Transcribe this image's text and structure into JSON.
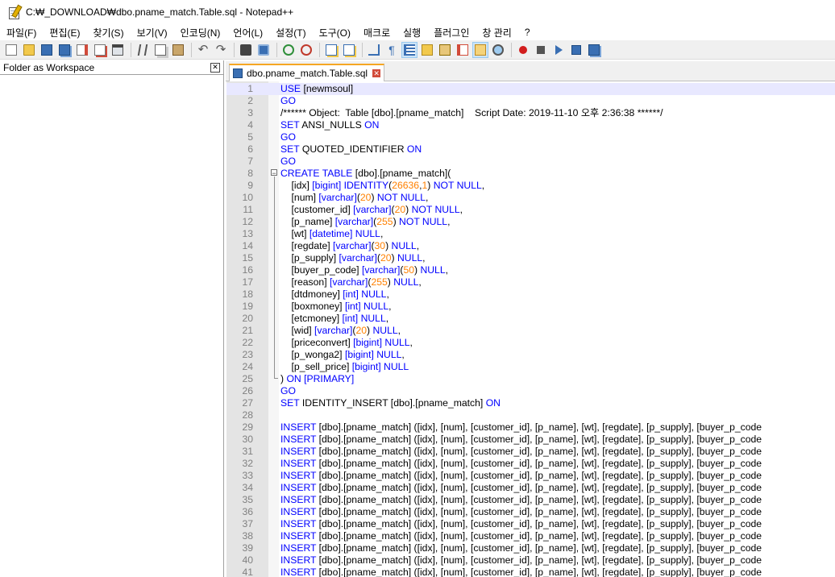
{
  "window": {
    "title": "C:₩_DOWNLOAD₩dbo.pname_match.Table.sql - Notepad++"
  },
  "menu": [
    {
      "label": "파일(F)",
      "name": "menu-file"
    },
    {
      "label": "편집(E)",
      "name": "menu-edit"
    },
    {
      "label": "찾기(S)",
      "name": "menu-search"
    },
    {
      "label": "보기(V)",
      "name": "menu-view"
    },
    {
      "label": "인코딩(N)",
      "name": "menu-encoding"
    },
    {
      "label": "언어(L)",
      "name": "menu-language"
    },
    {
      "label": "설정(T)",
      "name": "menu-settings"
    },
    {
      "label": "도구(O)",
      "name": "menu-tools"
    },
    {
      "label": "매크로",
      "name": "menu-macro"
    },
    {
      "label": "실행",
      "name": "menu-run"
    },
    {
      "label": "플러그인",
      "name": "menu-plugins"
    },
    {
      "label": "창 관리",
      "name": "menu-window"
    },
    {
      "label": "?",
      "name": "menu-help"
    }
  ],
  "toolbar": [
    {
      "icon": "new-file-icon",
      "cls": "ic-new"
    },
    {
      "icon": "open-file-icon",
      "cls": "ic-open"
    },
    {
      "icon": "save-icon",
      "cls": "ic-save"
    },
    {
      "icon": "save-all-icon",
      "cls": "ic-saveall"
    },
    {
      "icon": "close-file-icon",
      "cls": "ic-close"
    },
    {
      "icon": "close-all-icon",
      "cls": "ic-closeall"
    },
    {
      "icon": "print-icon",
      "cls": "ic-print"
    },
    {
      "sep": true
    },
    {
      "icon": "cut-icon",
      "cls": "ic-cut"
    },
    {
      "icon": "copy-icon",
      "cls": "ic-copy"
    },
    {
      "icon": "paste-icon",
      "cls": "ic-paste"
    },
    {
      "sep": true
    },
    {
      "icon": "undo-icon",
      "cls": "ic-undo",
      "glyph": "↶"
    },
    {
      "icon": "redo-icon",
      "cls": "ic-redo",
      "glyph": "↷"
    },
    {
      "sep": true
    },
    {
      "icon": "find-icon",
      "cls": "ic-find"
    },
    {
      "icon": "replace-icon",
      "cls": "ic-replace"
    },
    {
      "sep": true
    },
    {
      "icon": "zoom-in-icon",
      "cls": "ic-zoomin"
    },
    {
      "icon": "zoom-out-icon",
      "cls": "ic-zoomout"
    },
    {
      "sep": true
    },
    {
      "icon": "sync-vertical-icon",
      "cls": "ic-sync"
    },
    {
      "icon": "sync-horizontal-icon",
      "cls": "ic-sync"
    },
    {
      "sep": true
    },
    {
      "icon": "word-wrap-icon",
      "cls": "ic-wrap"
    },
    {
      "icon": "show-all-characters-icon",
      "cls": "ic-para",
      "glyph": "¶"
    },
    {
      "icon": "indent-guide-icon",
      "cls": "ic-indent",
      "active": true
    },
    {
      "icon": "user-defined-language-icon",
      "cls": "ic-lang"
    },
    {
      "icon": "document-map-icon",
      "cls": "ic-map"
    },
    {
      "icon": "function-list-icon",
      "cls": "ic-func"
    },
    {
      "icon": "folder-as-workspace-icon",
      "cls": "ic-folder",
      "active": true
    },
    {
      "icon": "monitoring-icon",
      "cls": "ic-monitor"
    },
    {
      "sep": true
    },
    {
      "icon": "record-macro-icon",
      "cls": "ic-rec"
    },
    {
      "icon": "stop-recording-icon",
      "cls": "ic-stop"
    },
    {
      "icon": "play-macro-icon",
      "cls": "ic-play"
    },
    {
      "icon": "play-macro-multiple-icon",
      "cls": "ic-playm"
    },
    {
      "icon": "save-macro-icon",
      "cls": "ic-savemacro"
    }
  ],
  "side_panel": {
    "title": "Folder as Workspace",
    "close": "✕"
  },
  "tab": {
    "label": "dbo.pname_match.Table.sql",
    "close": "✕"
  },
  "editor": {
    "current_line": 1,
    "lines": [
      {
        "n": "1",
        "segs": [
          [
            "kw",
            "USE "
          ],
          [
            "pl",
            "[newmsoul]"
          ]
        ]
      },
      {
        "n": "2",
        "segs": [
          [
            "kw",
            "GO"
          ]
        ]
      },
      {
        "n": "3",
        "segs": [
          [
            "pl",
            "/****** Object:  Table [dbo].[pname_match]    Script Date: 2019-11-10 오후 2:36:38 ******/"
          ]
        ]
      },
      {
        "n": "4",
        "segs": [
          [
            "kw",
            "SET "
          ],
          [
            "pl",
            "ANSI_NULLS "
          ],
          [
            "kw",
            "ON"
          ]
        ]
      },
      {
        "n": "5",
        "segs": [
          [
            "kw",
            "GO"
          ]
        ]
      },
      {
        "n": "6",
        "segs": [
          [
            "kw",
            "SET "
          ],
          [
            "pl",
            "QUOTED_IDENTIFIER "
          ],
          [
            "kw",
            "ON"
          ]
        ]
      },
      {
        "n": "7",
        "segs": [
          [
            "kw",
            "GO"
          ]
        ]
      },
      {
        "n": "8",
        "segs": [
          [
            "kw",
            "CREATE TABLE "
          ],
          [
            "pl",
            "[dbo].[pname_match]("
          ]
        ]
      },
      {
        "n": "9",
        "segs": [
          [
            "pl",
            "    [idx] "
          ],
          [
            "kw",
            "[bigint] IDENTITY"
          ],
          [
            "pl",
            "("
          ],
          [
            "num",
            "26636"
          ],
          [
            "pl",
            ","
          ],
          [
            "num",
            "1"
          ],
          [
            "pl",
            ") "
          ],
          [
            "kw",
            "NOT NULL"
          ],
          [
            "pl",
            ","
          ]
        ]
      },
      {
        "n": "10",
        "segs": [
          [
            "pl",
            "    [num] "
          ],
          [
            "kw",
            "[varchar]"
          ],
          [
            "pl",
            "("
          ],
          [
            "num",
            "20"
          ],
          [
            "pl",
            ") "
          ],
          [
            "kw",
            "NOT NULL"
          ],
          [
            "pl",
            ","
          ]
        ]
      },
      {
        "n": "11",
        "segs": [
          [
            "pl",
            "    [customer_id] "
          ],
          [
            "kw",
            "[varchar]"
          ],
          [
            "pl",
            "("
          ],
          [
            "num",
            "20"
          ],
          [
            "pl",
            ") "
          ],
          [
            "kw",
            "NOT NULL"
          ],
          [
            "pl",
            ","
          ]
        ]
      },
      {
        "n": "12",
        "segs": [
          [
            "pl",
            "    [p_name] "
          ],
          [
            "kw",
            "[varchar]"
          ],
          [
            "pl",
            "("
          ],
          [
            "num",
            "255"
          ],
          [
            "pl",
            ") "
          ],
          [
            "kw",
            "NOT NULL"
          ],
          [
            "pl",
            ","
          ]
        ]
      },
      {
        "n": "13",
        "segs": [
          [
            "pl",
            "    [wt] "
          ],
          [
            "kw",
            "[datetime] NULL"
          ],
          [
            "pl",
            ","
          ]
        ]
      },
      {
        "n": "14",
        "segs": [
          [
            "pl",
            "    [regdate] "
          ],
          [
            "kw",
            "[varchar]"
          ],
          [
            "pl",
            "("
          ],
          [
            "num",
            "30"
          ],
          [
            "pl",
            ") "
          ],
          [
            "kw",
            "NULL"
          ],
          [
            "pl",
            ","
          ]
        ]
      },
      {
        "n": "15",
        "segs": [
          [
            "pl",
            "    [p_supply] "
          ],
          [
            "kw",
            "[varchar]"
          ],
          [
            "pl",
            "("
          ],
          [
            "num",
            "20"
          ],
          [
            "pl",
            ") "
          ],
          [
            "kw",
            "NULL"
          ],
          [
            "pl",
            ","
          ]
        ]
      },
      {
        "n": "16",
        "segs": [
          [
            "pl",
            "    [buyer_p_code] "
          ],
          [
            "kw",
            "[varchar]"
          ],
          [
            "pl",
            "("
          ],
          [
            "num",
            "50"
          ],
          [
            "pl",
            ") "
          ],
          [
            "kw",
            "NULL"
          ],
          [
            "pl",
            ","
          ]
        ]
      },
      {
        "n": "17",
        "segs": [
          [
            "pl",
            "    [reason] "
          ],
          [
            "kw",
            "[varchar]"
          ],
          [
            "pl",
            "("
          ],
          [
            "num",
            "255"
          ],
          [
            "pl",
            ") "
          ],
          [
            "kw",
            "NULL"
          ],
          [
            "pl",
            ","
          ]
        ]
      },
      {
        "n": "18",
        "segs": [
          [
            "pl",
            "    [dtdmoney] "
          ],
          [
            "kw",
            "[int] NULL"
          ],
          [
            "pl",
            ","
          ]
        ]
      },
      {
        "n": "19",
        "segs": [
          [
            "pl",
            "    [boxmoney] "
          ],
          [
            "kw",
            "[int] NULL"
          ],
          [
            "pl",
            ","
          ]
        ]
      },
      {
        "n": "20",
        "segs": [
          [
            "pl",
            "    [etcmoney] "
          ],
          [
            "kw",
            "[int] NULL"
          ],
          [
            "pl",
            ","
          ]
        ]
      },
      {
        "n": "21",
        "segs": [
          [
            "pl",
            "    [wid] "
          ],
          [
            "kw",
            "[varchar]"
          ],
          [
            "pl",
            "("
          ],
          [
            "num",
            "20"
          ],
          [
            "pl",
            ") "
          ],
          [
            "kw",
            "NULL"
          ],
          [
            "pl",
            ","
          ]
        ]
      },
      {
        "n": "22",
        "segs": [
          [
            "pl",
            "    [priceconvert] "
          ],
          [
            "kw",
            "[bigint] NULL"
          ],
          [
            "pl",
            ","
          ]
        ]
      },
      {
        "n": "23",
        "segs": [
          [
            "pl",
            "    [p_wonga2] "
          ],
          [
            "kw",
            "[bigint] NULL"
          ],
          [
            "pl",
            ","
          ]
        ]
      },
      {
        "n": "24",
        "segs": [
          [
            "pl",
            "    [p_sell_price] "
          ],
          [
            "kw",
            "[bigint] NULL"
          ]
        ]
      },
      {
        "n": "25",
        "segs": [
          [
            "pl",
            ") "
          ],
          [
            "kw",
            "ON [PRIMARY]"
          ]
        ]
      },
      {
        "n": "26",
        "segs": [
          [
            "kw",
            "GO"
          ]
        ]
      },
      {
        "n": "27",
        "segs": [
          [
            "kw",
            "SET "
          ],
          [
            "pl",
            "IDENTITY_INSERT [dbo].[pname_match] "
          ],
          [
            "kw",
            "ON"
          ]
        ]
      },
      {
        "n": "28",
        "segs": []
      },
      {
        "n": "29",
        "segs": [
          [
            "kw",
            "INSERT "
          ],
          [
            "pl",
            "[dbo].[pname_match] ([idx], [num], [customer_id], [p_name], [wt], [regdate], [p_supply], [buyer_p_code"
          ]
        ]
      },
      {
        "n": "30",
        "segs": [
          [
            "kw",
            "INSERT "
          ],
          [
            "pl",
            "[dbo].[pname_match] ([idx], [num], [customer_id], [p_name], [wt], [regdate], [p_supply], [buyer_p_code"
          ]
        ]
      },
      {
        "n": "31",
        "segs": [
          [
            "kw",
            "INSERT "
          ],
          [
            "pl",
            "[dbo].[pname_match] ([idx], [num], [customer_id], [p_name], [wt], [regdate], [p_supply], [buyer_p_code"
          ]
        ]
      },
      {
        "n": "32",
        "segs": [
          [
            "kw",
            "INSERT "
          ],
          [
            "pl",
            "[dbo].[pname_match] ([idx], [num], [customer_id], [p_name], [wt], [regdate], [p_supply], [buyer_p_code"
          ]
        ]
      },
      {
        "n": "33",
        "segs": [
          [
            "kw",
            "INSERT "
          ],
          [
            "pl",
            "[dbo].[pname_match] ([idx], [num], [customer_id], [p_name], [wt], [regdate], [p_supply], [buyer_p_code"
          ]
        ]
      },
      {
        "n": "34",
        "segs": [
          [
            "kw",
            "INSERT "
          ],
          [
            "pl",
            "[dbo].[pname_match] ([idx], [num], [customer_id], [p_name], [wt], [regdate], [p_supply], [buyer_p_code"
          ]
        ]
      },
      {
        "n": "35",
        "segs": [
          [
            "kw",
            "INSERT "
          ],
          [
            "pl",
            "[dbo].[pname_match] ([idx], [num], [customer_id], [p_name], [wt], [regdate], [p_supply], [buyer_p_code"
          ]
        ]
      },
      {
        "n": "36",
        "segs": [
          [
            "kw",
            "INSERT "
          ],
          [
            "pl",
            "[dbo].[pname_match] ([idx], [num], [customer_id], [p_name], [wt], [regdate], [p_supply], [buyer_p_code"
          ]
        ]
      },
      {
        "n": "37",
        "segs": [
          [
            "kw",
            "INSERT "
          ],
          [
            "pl",
            "[dbo].[pname_match] ([idx], [num], [customer_id], [p_name], [wt], [regdate], [p_supply], [buyer_p_code"
          ]
        ]
      },
      {
        "n": "38",
        "segs": [
          [
            "kw",
            "INSERT "
          ],
          [
            "pl",
            "[dbo].[pname_match] ([idx], [num], [customer_id], [p_name], [wt], [regdate], [p_supply], [buyer_p_code"
          ]
        ]
      },
      {
        "n": "39",
        "segs": [
          [
            "kw",
            "INSERT "
          ],
          [
            "pl",
            "[dbo].[pname_match] ([idx], [num], [customer_id], [p_name], [wt], [regdate], [p_supply], [buyer_p_code"
          ]
        ]
      },
      {
        "n": "40",
        "segs": [
          [
            "kw",
            "INSERT "
          ],
          [
            "pl",
            "[dbo].[pname_match] ([idx], [num], [customer_id], [p_name], [wt], [regdate], [p_supply], [buyer_p_code"
          ]
        ]
      },
      {
        "n": "41",
        "segs": [
          [
            "kw",
            "INSERT "
          ],
          [
            "pl",
            "[dbo].[pname_match] ([idx], [num], [customer_id], [p_name], [wt], [regdate], [p_supply], [buyer_p_code"
          ]
        ]
      }
    ]
  }
}
